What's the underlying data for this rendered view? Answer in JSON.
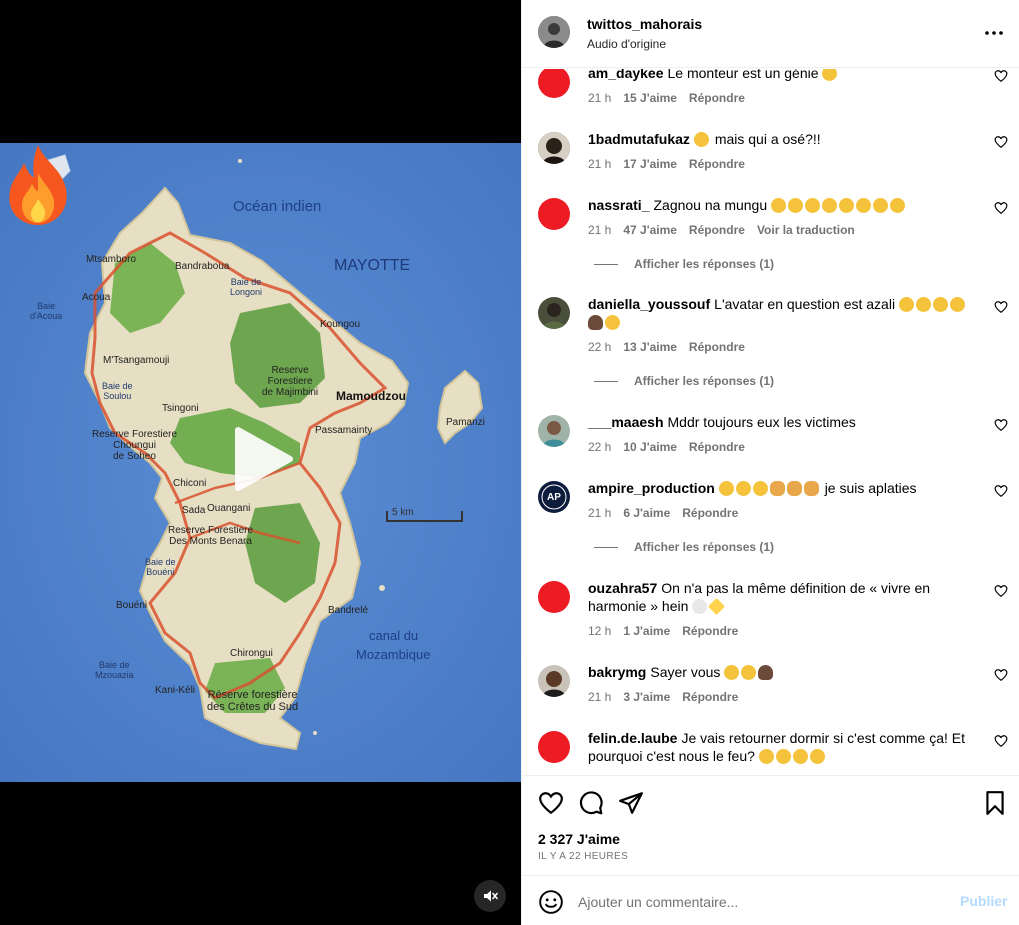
{
  "post": {
    "username": "twittos_mahorais",
    "audio": "Audio d'origine",
    "likes_total": "2 327 J'aime",
    "time_ago": "IL Y A 22 HEURES"
  },
  "map_labels": {
    "ocean": "Océan indien",
    "canal": "canal du",
    "mozambique": "Mozambique",
    "mayotte": "MAYOTTE",
    "mtsamboro": "Mtsamboro",
    "bandraboua": "Bandraboua",
    "acoua": "Acoua",
    "baie_acoua_1": "Baie",
    "baie_acoua_2": "d'Acoua",
    "baie_longoni_1": "Baie de",
    "baie_longoni_2": "Longoni",
    "koungou": "Koungou",
    "mtsangamouji": "M'Tsangamouji",
    "reserve_majimbini_1": "Reserve",
    "reserve_majimbini_2": "Forestiere",
    "reserve_majimbini_3": "de Majimbini",
    "baie_soulou_1": "Baie de",
    "baie_soulou_2": "Soulou",
    "mamoudzou": "Mamoudzou",
    "tsingoni": "Tsingoni",
    "pamanzi": "Pamanzi",
    "reserve_choungui_1": "Reserve Forestiere",
    "reserve_choungui_2": "Choungui",
    "reserve_choungui_3": "de Soheo",
    "passamainty": "Passamainty",
    "chiconi": "Chiconi",
    "sada": "Sada",
    "ouangani": "Ouangani",
    "scale": "5 km",
    "reserve_benara_1": "Reserve Forestiere",
    "reserve_benara_2": "Des Monts Benara",
    "baie_boueni_1": "Baie de",
    "baie_boueni_2": "Bouéni",
    "boueni": "Bouéni",
    "bandrele": "Bandrelé",
    "chirongui": "Chirongui",
    "baie_mzouazia_1": "Baie de",
    "baie_mzouazia_2": "Mzouazia",
    "kani_keli": "Kani-Kéli",
    "reserve_cretes_1": "Réserve forestière",
    "reserve_cretes_2": "des Crêtes du Sud"
  },
  "comments": [
    {
      "user": "am_daykee",
      "text": "Le monteur est un génie",
      "emojis": [
        "laugh"
      ],
      "time": "21 h",
      "likes": "15 J'aime",
      "reply": "Répondre",
      "avatar": "red"
    },
    {
      "user": "1badmutafukaz",
      "pre_emojis": [
        "rofl"
      ],
      "text": "mais qui a osé?!!",
      "emojis": [],
      "time": "21 h",
      "likes": "17 J'aime",
      "reply": "Répondre",
      "avatar": "photo"
    },
    {
      "user": "nassrati_",
      "text": "Zagnou na mungu",
      "emojis": [
        "cry",
        "cry",
        "cry",
        "cry",
        "cry",
        "laugh",
        "laugh",
        "laugh"
      ],
      "time": "21 h",
      "likes": "47 J'aime",
      "reply": "Répondre",
      "translate": "Voir la traduction",
      "replies": "Afficher les réponses (1)",
      "avatar": "red"
    },
    {
      "user": "daniella_youssouf",
      "text": "L'avatar en question est azali",
      "emojis": [
        "laugh",
        "laugh",
        "laugh",
        "laugh",
        "person",
        "cry"
      ],
      "time": "22 h",
      "likes": "13 J'aime",
      "reply": "Répondre",
      "replies": "Afficher les réponses (1)",
      "avatar": "photo"
    },
    {
      "user": "___maaesh",
      "text": "Mddr toujours eux les victimes",
      "emojis": [],
      "time": "22 h",
      "likes": "10 J'aime",
      "reply": "Répondre",
      "avatar": "photo"
    },
    {
      "user": "ampire_production",
      "pre_emojis": [
        "laugh",
        "laugh",
        "laugh",
        "clap",
        "clap",
        "clap"
      ],
      "text": "je suis aplaties",
      "emojis": [],
      "time": "21 h",
      "likes": "6 J'aime",
      "reply": "Répondre",
      "replies": "Afficher les réponses (1)",
      "avatar": "logo"
    },
    {
      "user": "ouzahra57",
      "text": "On n'a pas la même définition de « vivre en harmonie » hein",
      "emojis": [
        "skull",
        "spark"
      ],
      "time": "12 h",
      "likes": "1 J'aime",
      "reply": "Répondre",
      "avatar": "red"
    },
    {
      "user": "bakrymg",
      "text": "Sayer vous",
      "emojis": [
        "laugh",
        "laugh",
        "person"
      ],
      "time": "21 h",
      "likes": "3 J'aime",
      "reply": "Répondre",
      "avatar": "photo"
    },
    {
      "user": "felin.de.laube",
      "text": "Je vais retourner dormir si c'est comme ça! Et pourquoi c'est nous le feu?",
      "emojis": [
        "laugh",
        "sad",
        "sad",
        "sad"
      ],
      "avatar": "red"
    }
  ],
  "composer": {
    "placeholder": "Ajouter un commentaire...",
    "post_label": "Publier"
  }
}
